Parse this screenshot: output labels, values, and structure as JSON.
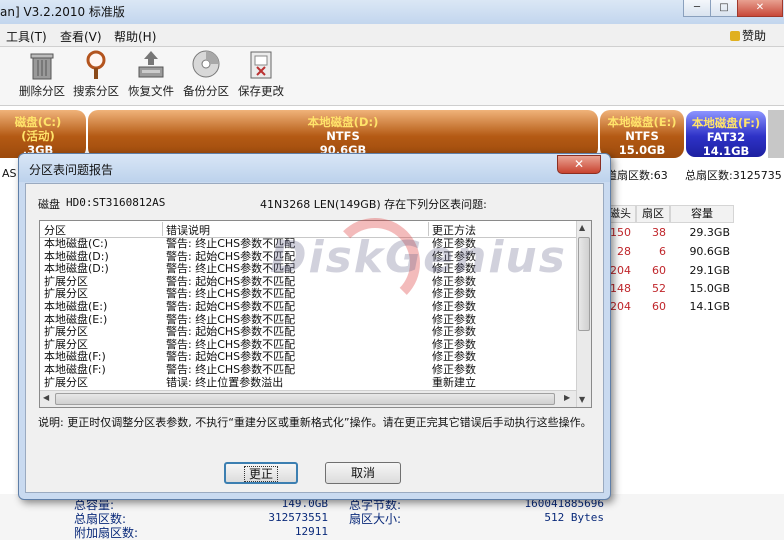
{
  "window": {
    "title": "an] V3.2.2010 标准版",
    "min": "─",
    "max": "□",
    "close": "✕"
  },
  "menu": {
    "items": [
      "工具(T)",
      "查看(V)",
      "帮助(H)"
    ],
    "help_right": "赞助"
  },
  "toolbar": {
    "buttons": [
      {
        "label": "删除分区",
        "icon": "trash-icon"
      },
      {
        "label": "搜索分区",
        "icon": "magnifier-icon"
      },
      {
        "label": "恢复文件",
        "icon": "restore-icon"
      },
      {
        "label": "备份分区",
        "icon": "backup-disc-icon"
      },
      {
        "label": "保存更改",
        "icon": "save-icon"
      }
    ]
  },
  "disk_map": {
    "partitions": [
      {
        "name": "磁盘(C:)",
        "fs": "(活动)",
        "size": ".3GB"
      },
      {
        "name": "本地磁盘(D:)",
        "fs": "NTFS",
        "size": "90.6GB"
      },
      {
        "name": "本地磁盘(E:)",
        "fs": "NTFS",
        "size": "15.0GB"
      },
      {
        "name": "本地磁盘(F:)",
        "fs": "FAT32",
        "size": "14.1GB"
      }
    ]
  },
  "background": {
    "left_label": "AS",
    "sector_info": "道扇区数:63",
    "total_sectors_label": "总扇区数:3125735",
    "table_headers": [
      "磁头",
      "扇区",
      "容量"
    ],
    "table_rows": [
      {
        "head": "150",
        "sector": "38",
        "size": "29.3GB"
      },
      {
        "head": "28",
        "sector": "6",
        "size": "90.6GB"
      },
      {
        "head": "204",
        "sector": "60",
        "size": "29.1GB"
      },
      {
        "head": "148",
        "sector": "52",
        "size": "15.0GB"
      },
      {
        "head": "204",
        "sector": "60",
        "size": "14.1GB"
      }
    ],
    "bottom": {
      "total_capacity_label": "总容量:",
      "total_capacity_value": "149.0GB",
      "total_bytes_label": "总字节数:",
      "total_bytes_value": "160041885696",
      "total_sectors_label": "总扇区数:",
      "total_sectors_value": "312573551",
      "sector_size_label": "扇区大小:",
      "sector_size_value": "512 Bytes",
      "extra_sectors_label": "附加扇区数:",
      "extra_sectors_value": "12911"
    }
  },
  "watermark": "DiskGenius",
  "dialog": {
    "title": "分区表问题报告",
    "close": "✕",
    "disk_label": "磁盘",
    "disk_model": "HD0:ST3160812AS",
    "disk_geometry": "41N3268 LEN(149GB) 存在下列分区表问题:",
    "columns": [
      "分区",
      "错误说明",
      "更正方法"
    ],
    "rows": [
      {
        "partition": "本地磁盘(C:)",
        "error": "警告: 终止CHS参数不匹配",
        "fix": "修正参数"
      },
      {
        "partition": "本地磁盘(D:)",
        "error": "警告: 起始CHS参数不匹配",
        "fix": "修正参数"
      },
      {
        "partition": "本地磁盘(D:)",
        "error": "警告: 终止CHS参数不匹配",
        "fix": "修正参数"
      },
      {
        "partition": "扩展分区",
        "error": "警告: 起始CHS参数不匹配",
        "fix": "修正参数"
      },
      {
        "partition": "扩展分区",
        "error": "警告: 终止CHS参数不匹配",
        "fix": "修正参数"
      },
      {
        "partition": "本地磁盘(E:)",
        "error": "警告: 起始CHS参数不匹配",
        "fix": "修正参数"
      },
      {
        "partition": "本地磁盘(E:)",
        "error": "警告: 终止CHS参数不匹配",
        "fix": "修正参数"
      },
      {
        "partition": "扩展分区",
        "error": "警告: 起始CHS参数不匹配",
        "fix": "修正参数"
      },
      {
        "partition": "扩展分区",
        "error": "警告: 终止CHS参数不匹配",
        "fix": "修正参数"
      },
      {
        "partition": "本地磁盘(F:)",
        "error": "警告: 起始CHS参数不匹配",
        "fix": "修正参数"
      },
      {
        "partition": "本地磁盘(F:)",
        "error": "警告: 终止CHS参数不匹配",
        "fix": "修正参数"
      },
      {
        "partition": "扩展分区",
        "error": "错误: 终止位置参数溢出",
        "fix": "重新建立"
      }
    ],
    "note": "说明: 更正时仅调整分区表参数, 不执行“重建分区或重新格式化”操作。请在更正完其它错误后手动执行这些操作。",
    "ok": "更正",
    "cancel": "取消"
  }
}
